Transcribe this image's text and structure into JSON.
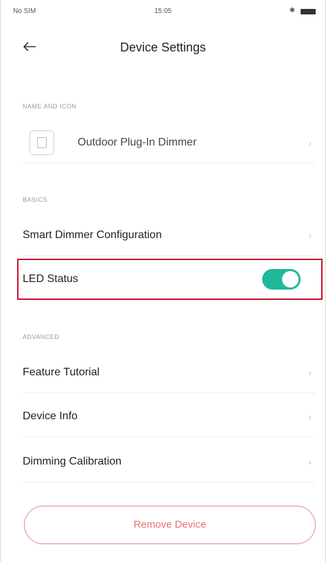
{
  "status_bar": {
    "carrier": "No SIM",
    "time": "15:05"
  },
  "header": {
    "title": "Device Settings"
  },
  "sections": {
    "name_icon": {
      "label": "NAME AND ICON",
      "device_name": "Outdoor Plug-In Dimmer"
    },
    "basics": {
      "label": "BASICS",
      "smart_dimmer": "Smart Dimmer Configuration",
      "led_status": "LED Status",
      "led_enabled": true
    },
    "advanced": {
      "label": "ADVANCED",
      "feature_tutorial": "Feature Tutorial",
      "device_info": "Device Info",
      "dimming_calibration": "Dimming Calibration"
    }
  },
  "remove_button": "Remove Device",
  "colors": {
    "accent": "#1fb89a",
    "remove": "#e8746c",
    "highlight": "#c8102e"
  },
  "icons": {
    "chevron": "›",
    "back": "arrow-left"
  }
}
